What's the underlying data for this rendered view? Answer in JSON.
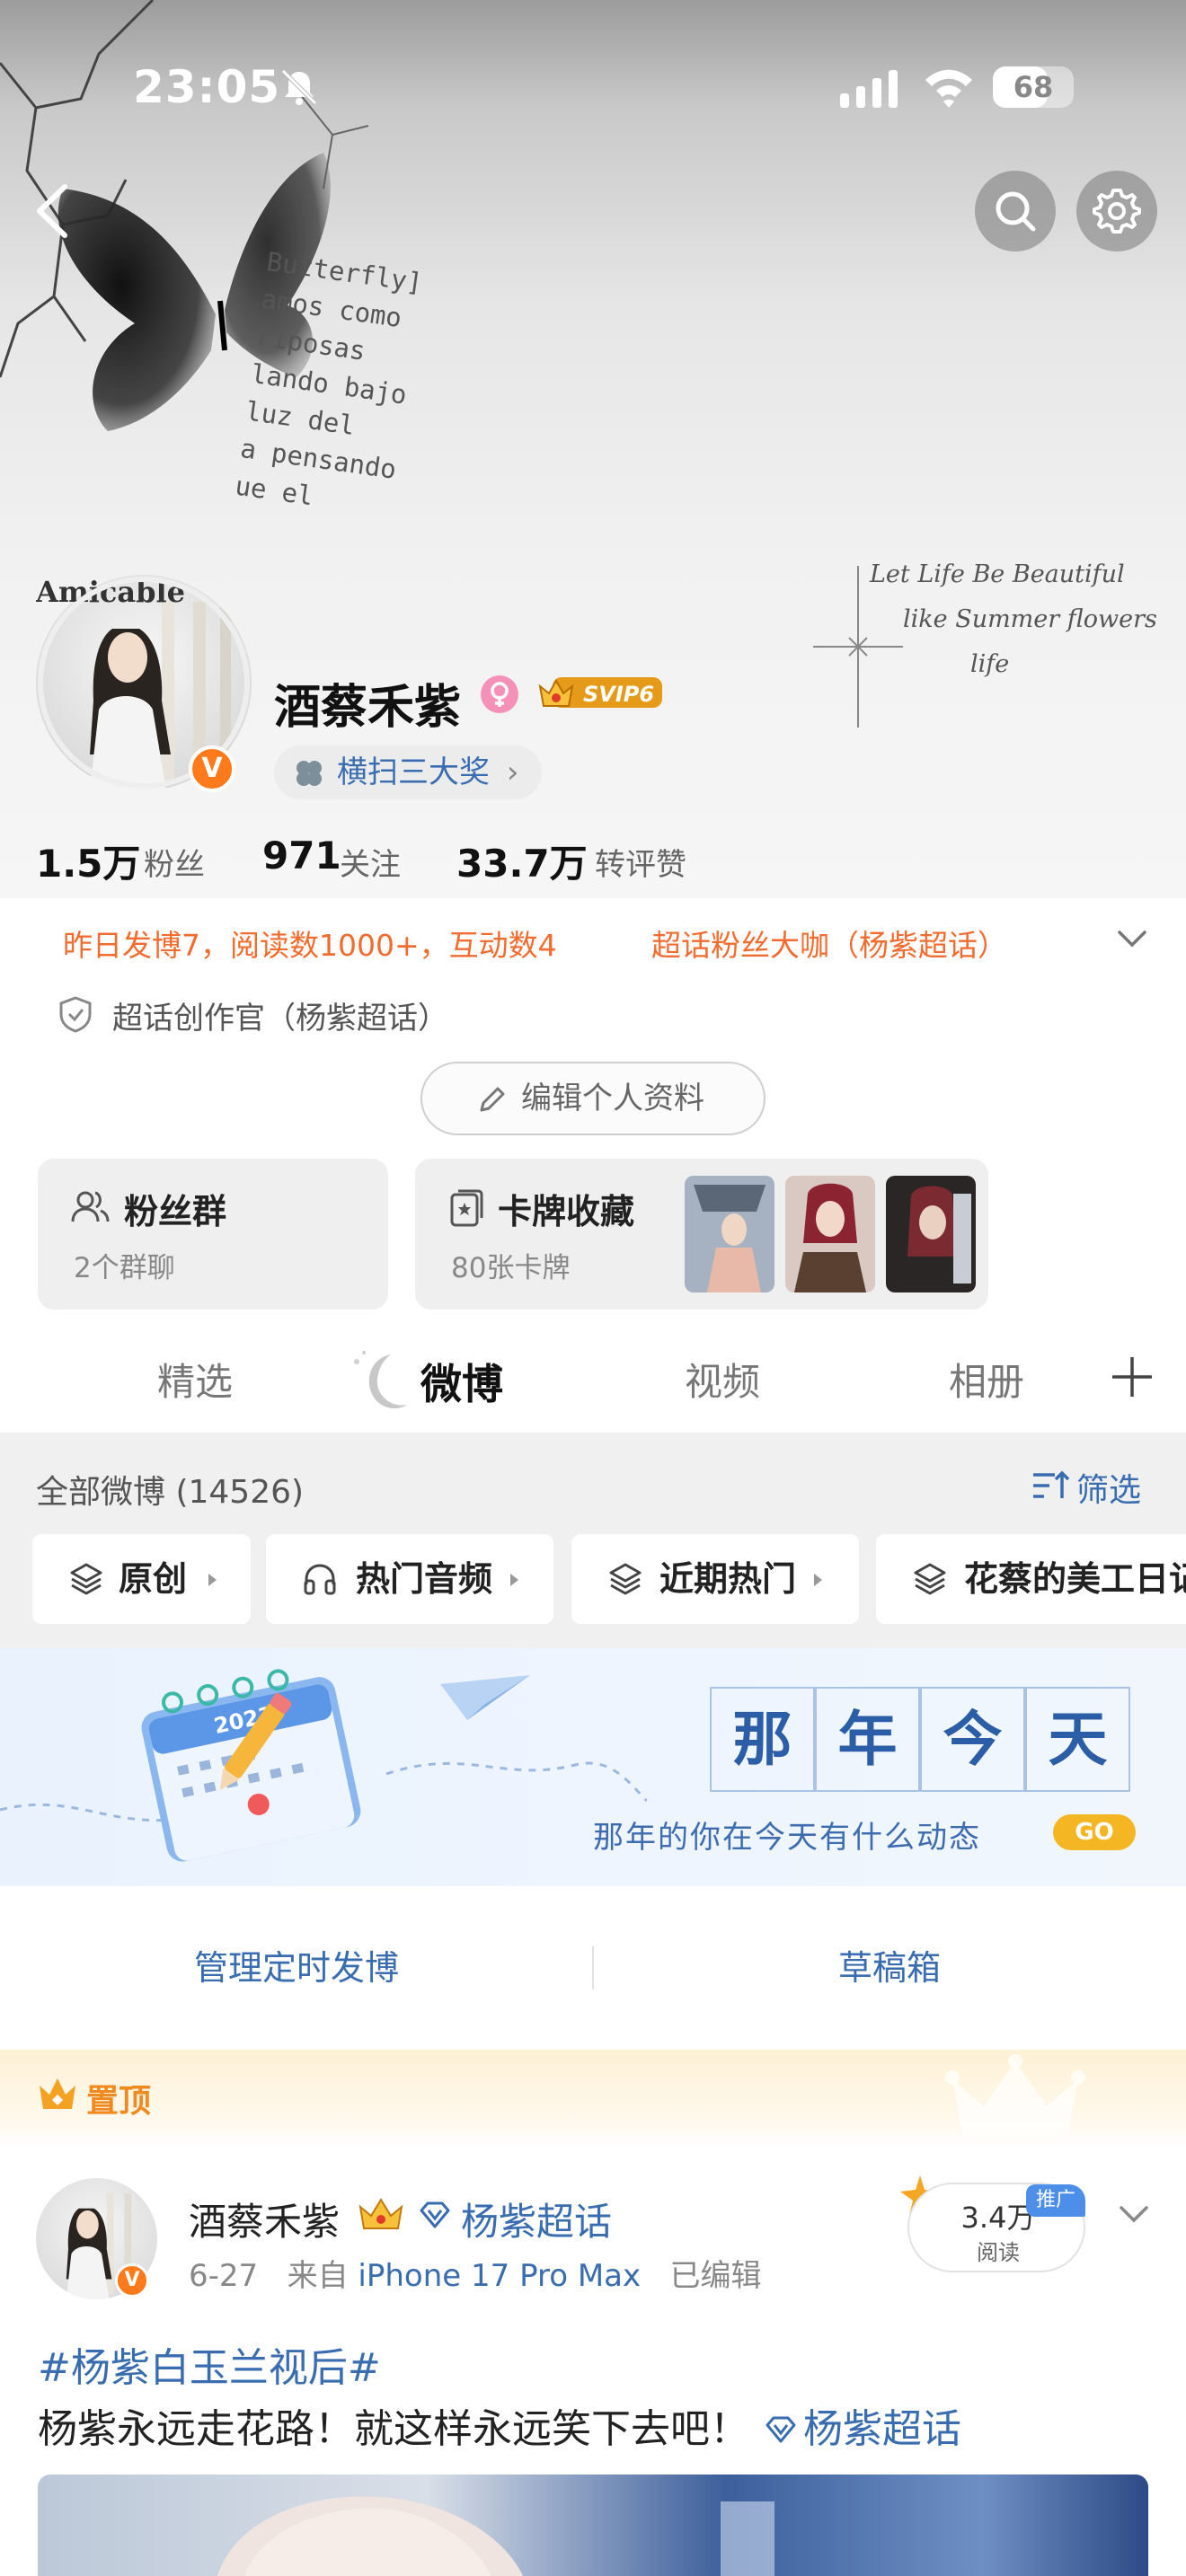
{
  "status_bar": {
    "time": "23:05",
    "battery": "68",
    "battery_level": 0.68
  },
  "cover": {
    "words": [
      "Butterfly]",
      "amos como",
      "riposas",
      "lando bajo",
      "luz del",
      "a pensando",
      "ue el"
    ],
    "quote_lines": [
      "Let Life Be Beautiful",
      "like Summer flowers",
      "life"
    ],
    "avatar_text": "Amicable"
  },
  "profile": {
    "name": "酒蔡禾紫",
    "vip": "SVIP6",
    "award": "横扫三大奖",
    "award_arrow": "›",
    "verify": "V",
    "stats": [
      {
        "num": "1.5万",
        "label": "粉丝"
      },
      {
        "num": "971",
        "label": "关注"
      },
      {
        "num": "33.7万",
        "label": "转评赞"
      }
    ],
    "activity": "昨日发博7，阅读数1000+，互动数4",
    "fan_title": "超话粉丝大咖（杨紫超话）",
    "creator": "超话创作官（杨紫超话）",
    "edit_label": "编辑个人资料"
  },
  "cards": {
    "fans_title": "粉丝群",
    "fans_sub": "2个群聊",
    "cards_title": "卡牌收藏",
    "cards_sub": "80张卡牌"
  },
  "tabs": [
    "精选",
    "微博",
    "视频",
    "相册"
  ],
  "filter": {
    "all_count": "全部微博 (14526)",
    "filter_label": "筛选",
    "chips": [
      "原创",
      "热门音频",
      "近期热门",
      "花蔡的美工日记"
    ]
  },
  "banner": {
    "chars": [
      "那",
      "年",
      "今",
      "天"
    ],
    "subtitle": "那年的你在今天有什么动态",
    "go": "GO",
    "calendar_year": "2023"
  },
  "manage": {
    "scheduled": "管理定时发博",
    "drafts": "草稿箱"
  },
  "pinned": {
    "label": "置顶"
  },
  "post": {
    "user": "酒蔡禾紫",
    "topic": "杨紫超话",
    "date": "6-27",
    "source_prefix": "来自",
    "device": "iPhone 17 Pro Max",
    "edited": "已编辑",
    "reads_num": "3.4万",
    "reads_label": "阅读",
    "promo": "推广",
    "hashtag": "#杨紫白玉兰视后#",
    "text": "杨紫永远走花路！就这样永远笑下去吧！",
    "text_topic": "杨紫超话"
  },
  "colors": {
    "link_blue": "#3a6db0",
    "orange": "#f26c2f",
    "gold": "#f5b624"
  }
}
